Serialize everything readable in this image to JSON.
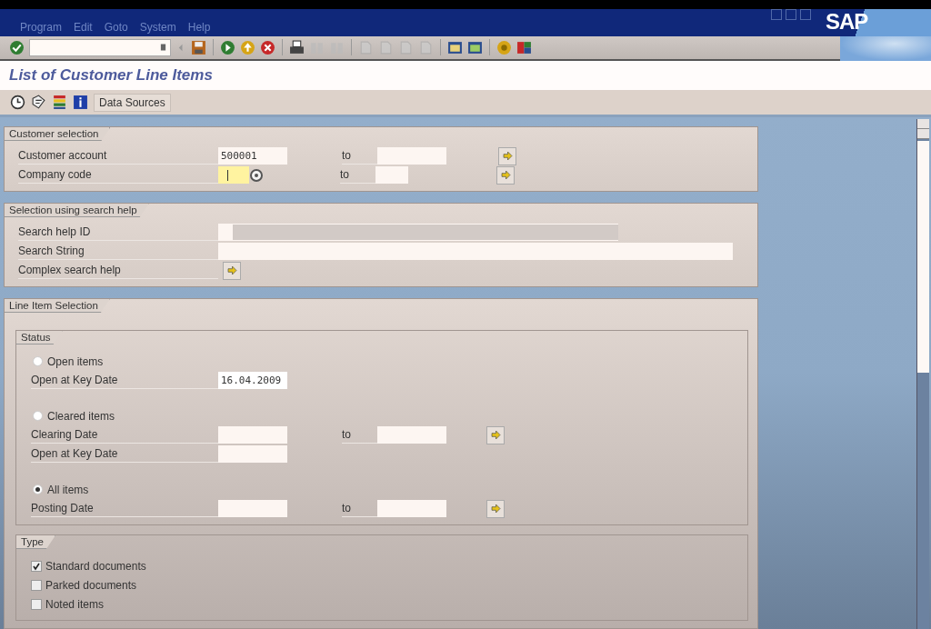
{
  "menu": [
    {
      "label": "Program"
    },
    {
      "label": "Edit"
    },
    {
      "label": "Goto"
    },
    {
      "label": "System"
    },
    {
      "label": "Help"
    }
  ],
  "logo": "SAP",
  "title": "List of Customer Line Items",
  "app_toolbar": {
    "button": "Data Sources"
  },
  "sections": [
    {
      "title": "Customer selection",
      "rows": [
        {
          "kind": "range",
          "label": "Customer account",
          "value": "500001",
          "to": "to"
        },
        {
          "kind": "code_range",
          "label": "Company code",
          "focused": true,
          "to": "to"
        }
      ]
    },
    {
      "title": "Selection using search help",
      "rows": [
        {
          "kind": "id",
          "label": "Search help ID"
        },
        {
          "kind": "long",
          "label": "Search String"
        },
        {
          "kind": "button",
          "label": "Complex search help"
        }
      ]
    },
    {
      "title": "Line Item Selection",
      "groups": [
        {
          "title": "Status",
          "rows": [
            {
              "kind": "radio",
              "label": "Open items",
              "selected": false
            },
            {
              "kind": "single",
              "label": "Open at Key Date",
              "value": "16.04.2009"
            },
            {
              "kind": "radio",
              "label": "Cleared items",
              "selected": false
            },
            {
              "kind": "range",
              "label": "Clearing Date",
              "to": "to"
            },
            {
              "kind": "single",
              "label": "Open at Key Date"
            },
            {
              "kind": "radio",
              "label": "All items",
              "selected": true
            },
            {
              "kind": "range",
              "label": "Posting Date",
              "to": "to"
            }
          ]
        },
        {
          "title": "Type",
          "rows": [
            {
              "kind": "checkbox",
              "label": "Standard documents",
              "checked": true
            },
            {
              "kind": "checkbox",
              "label": "Parked documents",
              "checked": false
            },
            {
              "kind": "checkbox",
              "label": "Noted items",
              "checked": false
            }
          ]
        }
      ]
    }
  ]
}
